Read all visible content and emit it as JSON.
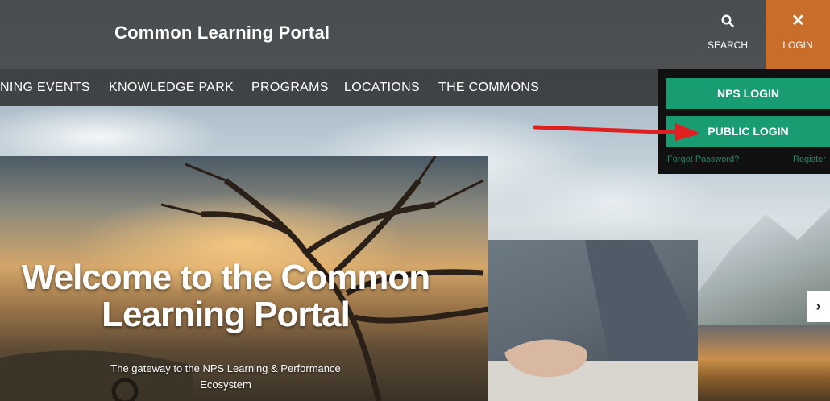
{
  "header": {
    "site_title": "Common Learning Portal",
    "search_label": "SEARCH",
    "login_label": "LOGIN",
    "login_icon": "close-icon",
    "login_color": "#c96d2a"
  },
  "nav": {
    "items": [
      {
        "label": "NING EVENTS"
      },
      {
        "label": "KNOWLEDGE PARK"
      },
      {
        "label": "PROGRAMS"
      },
      {
        "label": "LOCATIONS"
      },
      {
        "label": "THE COMMONS"
      }
    ]
  },
  "login_dropdown": {
    "nps_login": "NPS LOGIN",
    "public_login": "PUBLIC LOGIN",
    "forgot_password": "Forgot Password?",
    "register": "Register",
    "button_color": "#1a9c73"
  },
  "hero": {
    "title_line1": "Welcome to the Common",
    "title_line2": "Learning Portal",
    "subtitle_line1": "The gateway to the NPS Learning & Performance",
    "subtitle_line2": "Ecosystem"
  },
  "carousel": {
    "next_icon": "chevron-right-icon"
  },
  "annotation": {
    "arrow_color": "#e02020"
  }
}
